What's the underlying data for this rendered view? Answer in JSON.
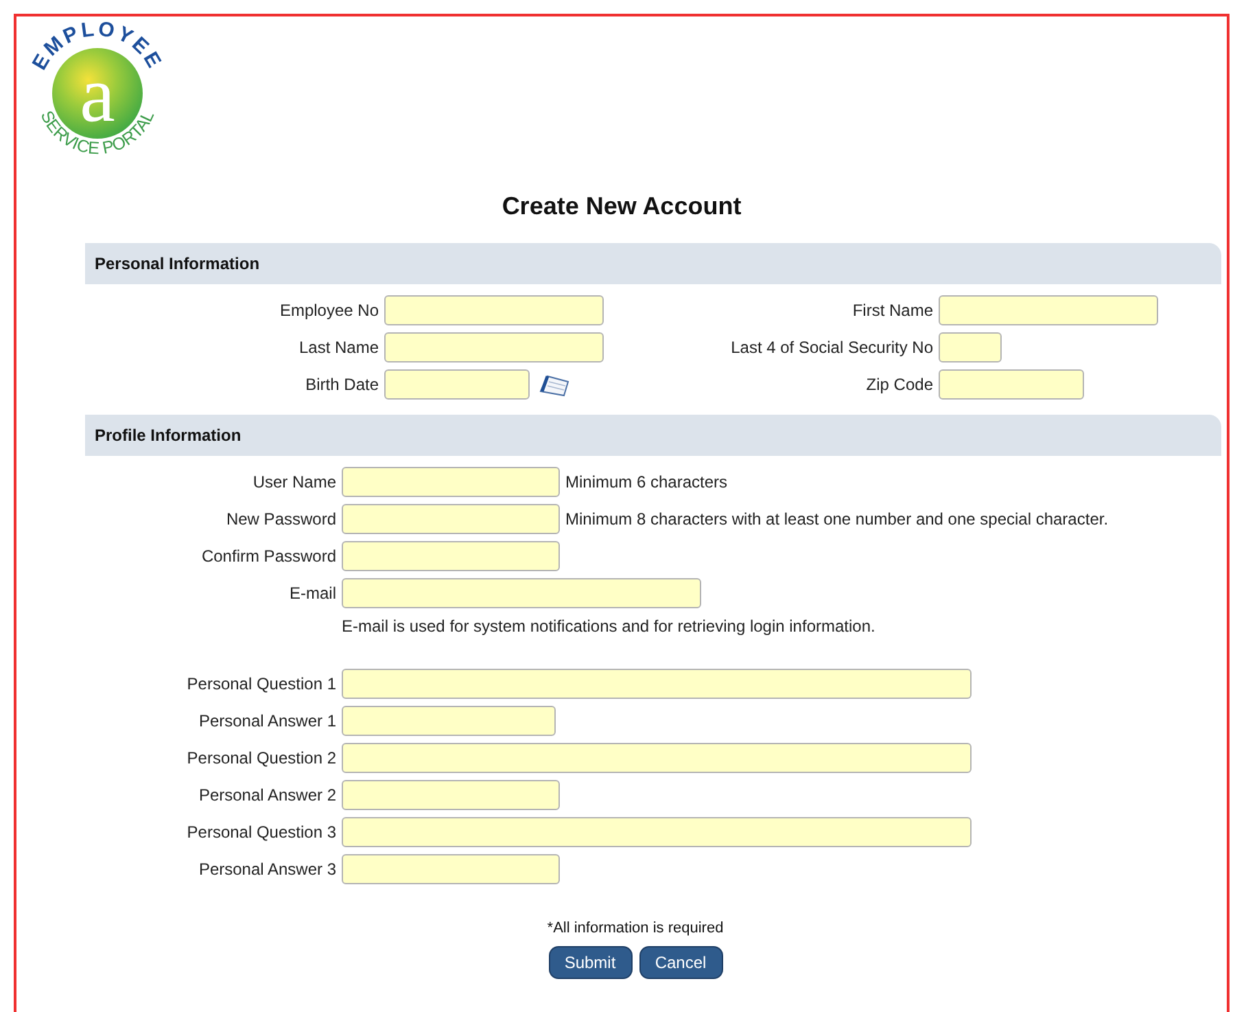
{
  "logo": {
    "top_text": "EMPLOYEE",
    "letter": "a",
    "bottom_text": "SERVICE PORTAL"
  },
  "title": "Create New Account",
  "personal": {
    "heading": "Personal Information",
    "rows": [
      [
        {
          "label": "Employee No",
          "kind": "text"
        },
        {
          "label": "First Name",
          "kind": "text"
        }
      ],
      [
        {
          "label": "Last Name",
          "kind": "text"
        },
        {
          "label": "Last 4 of Social Security No",
          "kind": "text"
        }
      ],
      [
        {
          "label": "Birth Date",
          "kind": "date"
        },
        {
          "label": "Zip Code",
          "kind": "text"
        }
      ]
    ]
  },
  "profile": {
    "heading": "Profile Information",
    "fields": [
      {
        "label": "User Name",
        "hint": "Minimum 6 characters"
      },
      {
        "label": "New Password",
        "hint": "Minimum 8 characters with at least one number and one special character."
      },
      {
        "label": "Confirm Password"
      },
      {
        "label": "E-mail",
        "note": "E-mail is used for system notifications and for retrieving login information."
      },
      {
        "label": "Personal Question 1"
      },
      {
        "label": "Personal Answer 1"
      },
      {
        "label": "Personal Question 2"
      },
      {
        "label": "Personal Answer 2"
      },
      {
        "label": "Personal Question 3"
      },
      {
        "label": "Personal Answer 3"
      }
    ]
  },
  "required_note": "*All information is required",
  "buttons": [
    "Submit",
    "Cancel"
  ]
}
